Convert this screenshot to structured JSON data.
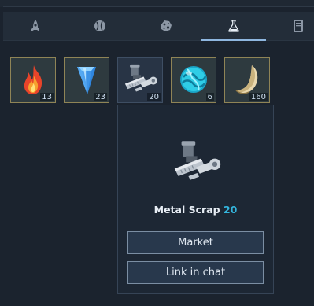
{
  "tabs": [
    {
      "icon": "rocket-icon",
      "active": false
    },
    {
      "icon": "planet-icon",
      "active": false
    },
    {
      "icon": "asteroid-icon",
      "active": false
    },
    {
      "icon": "flask-icon",
      "active": true
    },
    {
      "icon": "book-icon",
      "active": false
    }
  ],
  "inventory": [
    {
      "icon": "flame-icon",
      "qty": "13",
      "selected": false
    },
    {
      "icon": "crystal-icon",
      "qty": "23",
      "selected": false
    },
    {
      "icon": "metal-scrap-icon",
      "qty": "20",
      "selected": true
    },
    {
      "icon": "energy-orb-icon",
      "qty": "6",
      "selected": false
    },
    {
      "icon": "fang-icon",
      "qty": "160",
      "selected": false
    }
  ],
  "popup": {
    "item_name": "Metal Scrap",
    "item_count": "20",
    "market_label": "Market",
    "link_label": "Link in chat"
  },
  "colors": {
    "accent": "#34b6de",
    "slot_border": "#8f8456",
    "tab_active": "#8fb7e0"
  }
}
